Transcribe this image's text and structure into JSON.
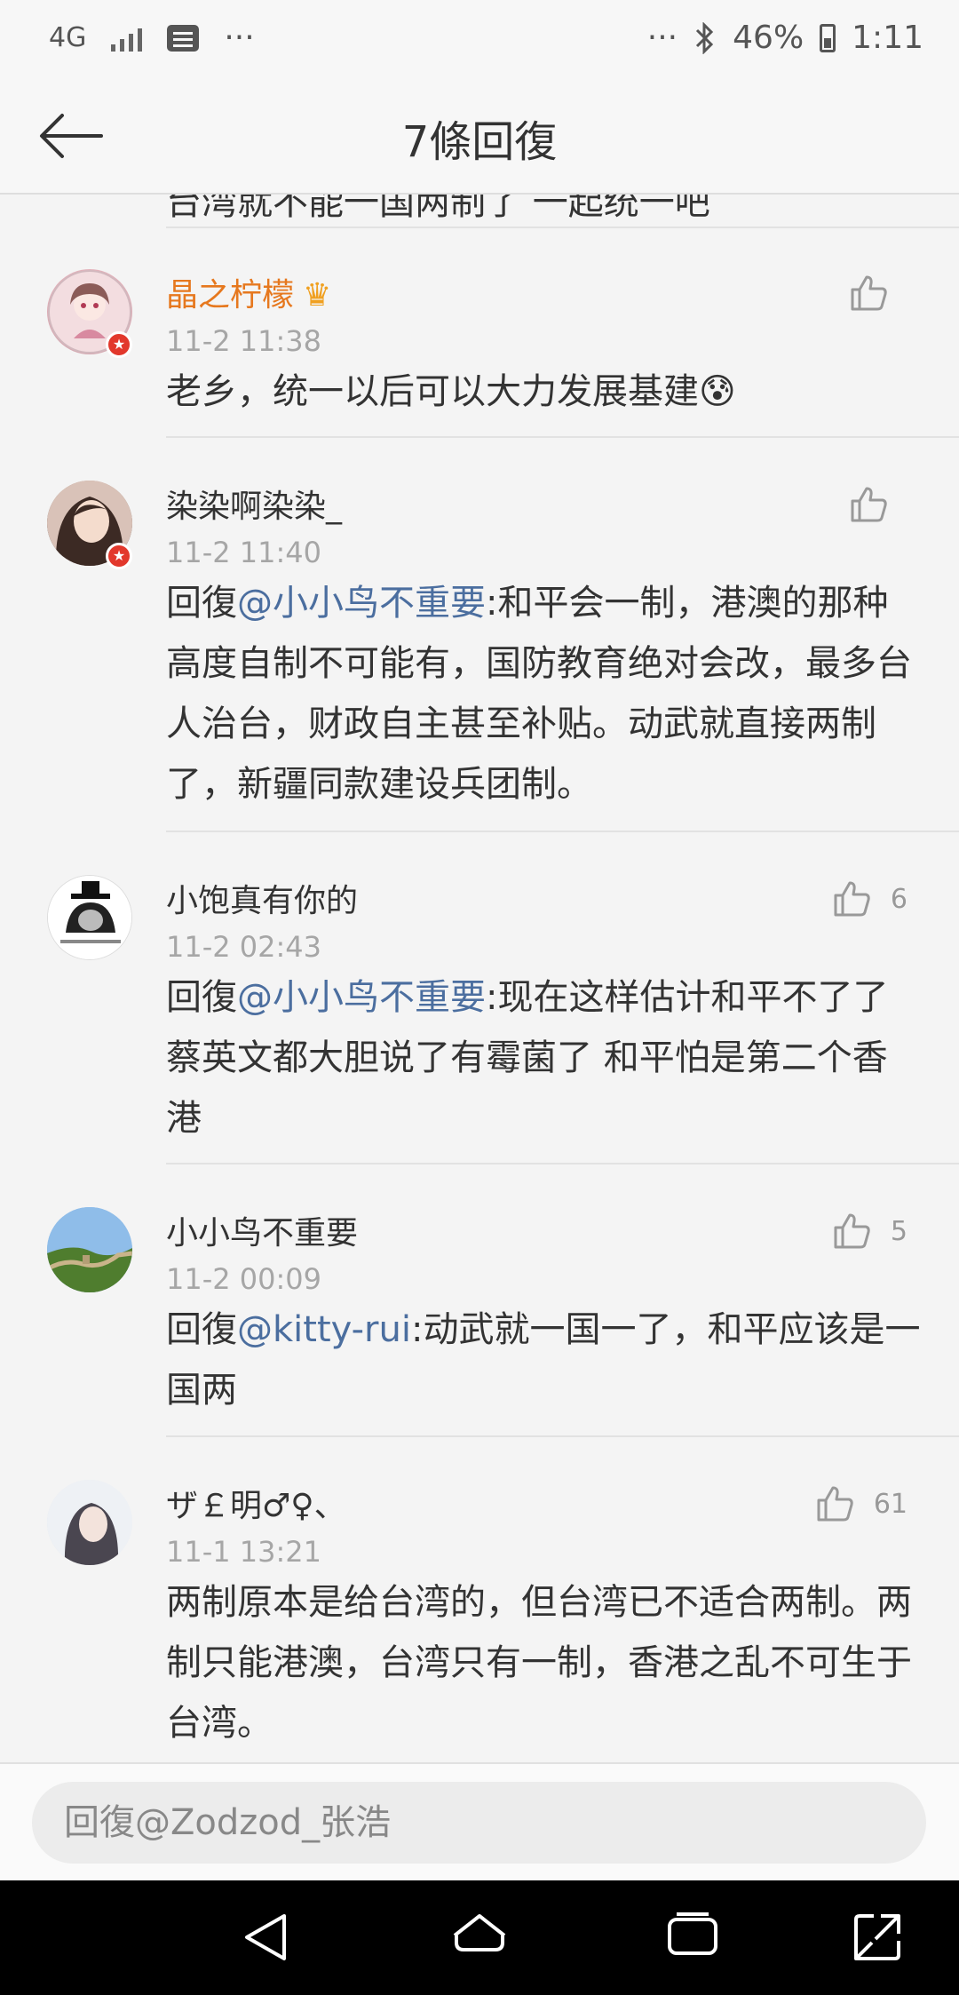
{
  "status_bar": {
    "network": "4G",
    "more_left": "···",
    "more_right": "···",
    "battery": "46%",
    "time": "1:11"
  },
  "header": {
    "title": "7條回復"
  },
  "list": {
    "cut_off_text": "台湾就不能一国两制了 一起统一吧",
    "comments": [
      {
        "name": "晶之柠檬",
        "time": "11-2 11:38",
        "text": "老乡，统一以后可以大力发展基建😰",
        "likes": ""
      },
      {
        "name": "染染啊染染_",
        "time": "11-2 11:40",
        "prefix": "回復",
        "mention": "@小小鸟不重要",
        "text": ":和平会一制，港澳的那种高度自制不可能有，国防教育绝对会改，最多台人治台，财政自主甚至补贴。动武就直接两制了，新疆同款建设兵团制。",
        "likes": ""
      },
      {
        "name": "小饱真有你的",
        "time": "11-2 02:43",
        "prefix": "回復",
        "mention": "@小小鸟不重要",
        "text": ":现在这样估计和平不了了 蔡英文都大胆说了有霉菌了 和平怕是第二个香港",
        "likes": "6"
      },
      {
        "name": "小小鸟不重要",
        "time": "11-2 00:09",
        "prefix": "回復",
        "mention": "@kitty-rui",
        "text": ":动武就一国一了，和平应该是一国两",
        "likes": "5"
      },
      {
        "name": "ザ￡明♂♀、",
        "time": "11-1 13:21",
        "text": "两制原本是给台湾的，但台湾已不适合两制。两制只能港澳，台湾只有一制，香港之乱不可生于台湾。",
        "likes": "61"
      }
    ]
  },
  "input": {
    "placeholder": "回復@Zodzod_张浩"
  },
  "colors": {
    "gold_name": "#e6781e",
    "mention": "#4b6e9f",
    "badge": "#e2382c"
  }
}
